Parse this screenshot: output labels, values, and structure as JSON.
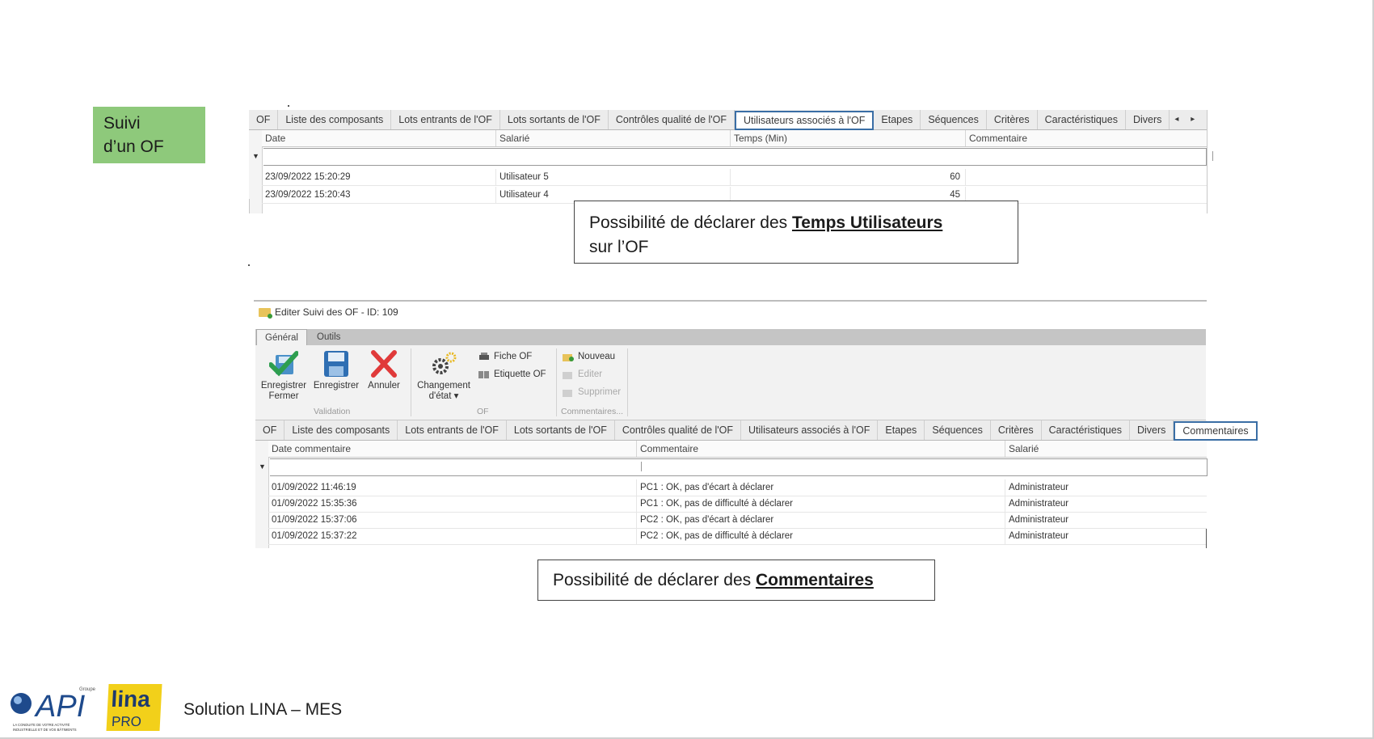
{
  "slide": {
    "section_label_line1": "Suivi",
    "section_label_line2": "d’un OF",
    "footer": "Solution LINA – MES"
  },
  "top_panel": {
    "tabs": [
      "OF",
      "Liste des composants",
      "Lots entrants de l'OF",
      "Lots sortants de l'OF",
      "Contrôles qualité de l'OF",
      "Utilisateurs associés à l'OF",
      "Etapes",
      "Séquences",
      "Critères",
      "Caractéristiques",
      "Divers"
    ],
    "active_tab": "Utilisateurs associés à l'OF",
    "scroll_arrows": "◂ ▸",
    "columns": [
      "Date",
      "Salarié",
      "Temps (Min)",
      "Commentaire"
    ],
    "rows": [
      {
        "date": "23/09/2022 15:20:29",
        "salarie": "Utilisateur 5",
        "temps": "60",
        "commentaire": ""
      },
      {
        "date": "23/09/2022 15:20:43",
        "salarie": "Utilisateur 4",
        "temps": "45",
        "commentaire": ""
      }
    ]
  },
  "callout_1": {
    "text_before": "Possibilité de déclarer des ",
    "emphasis": "Temps Utilisateurs",
    "text_after": "sur l’OF"
  },
  "edit_window": {
    "title": "Editer Suivi des OF - ID: 109",
    "ribbon_tabs": [
      "Général",
      "Outils"
    ],
    "active_ribbon_tab": "Général",
    "buttons": {
      "save_close_line1": "Enregistrer",
      "save_close_line2": "Fermer",
      "save": "Enregistrer",
      "cancel": "Annuler",
      "change_state_line1": "Changement",
      "change_state_line2": "d'état ▾",
      "fiche_of": "Fiche OF",
      "etiquette_of": "Etiquette OF",
      "nouveau": "Nouveau",
      "editer": "Editer",
      "supprimer": "Supprimer"
    },
    "groups": {
      "validation": "Validation",
      "of": "OF",
      "commentaires": "Commentaires..."
    },
    "tabs": [
      "OF",
      "Liste des composants",
      "Lots entrants de l'OF",
      "Lots sortants de l'OF",
      "Contrôles qualité de l'OF",
      "Utilisateurs associés à l'OF",
      "Etapes",
      "Séquences",
      "Critères",
      "Caractéristiques",
      "Divers",
      "Commentaires"
    ],
    "active_tab": "Commentaires",
    "columns": [
      "Date commentaire",
      "Commentaire",
      "Salarié"
    ],
    "rows": [
      {
        "date": "01/09/2022 11:46:19",
        "commentaire": "PC1 : OK, pas d'écart à déclarer",
        "salarie": "Administrateur"
      },
      {
        "date": "01/09/2022 15:35:36",
        "commentaire": "PC1 : OK, pas de difficulté à déclarer",
        "salarie": "Administrateur"
      },
      {
        "date": "01/09/2022 15:37:06",
        "commentaire": "PC2 : OK, pas d'écart à déclarer",
        "salarie": "Administrateur"
      },
      {
        "date": "01/09/2022 15:37:22",
        "commentaire": "PC2 : OK, pas de difficulté à déclarer",
        "salarie": "Administrateur"
      }
    ]
  },
  "callout_2": {
    "text_before": "Possibilité de déclarer des ",
    "emphasis": "Commentaires"
  },
  "logos": {
    "api_text": "API",
    "api_group": "Groupe",
    "api_tagline": "LA CONDUITE DE VOTRE ACTIVITÉ INDUSTRIELLE ET DE VOS BÂTIMENTS",
    "lina_text": "lina",
    "lina_sub": "PRO"
  },
  "colors": {
    "green_box": "#8ec97b",
    "active_tab_border": "#3a6ea5",
    "ribbon_bar": "#c5c5c5",
    "check_green": "#2e9e4f",
    "cancel_red": "#e03a3a",
    "save_blue": "#2f6fb3",
    "lina_yellow": "#f2d01a"
  }
}
